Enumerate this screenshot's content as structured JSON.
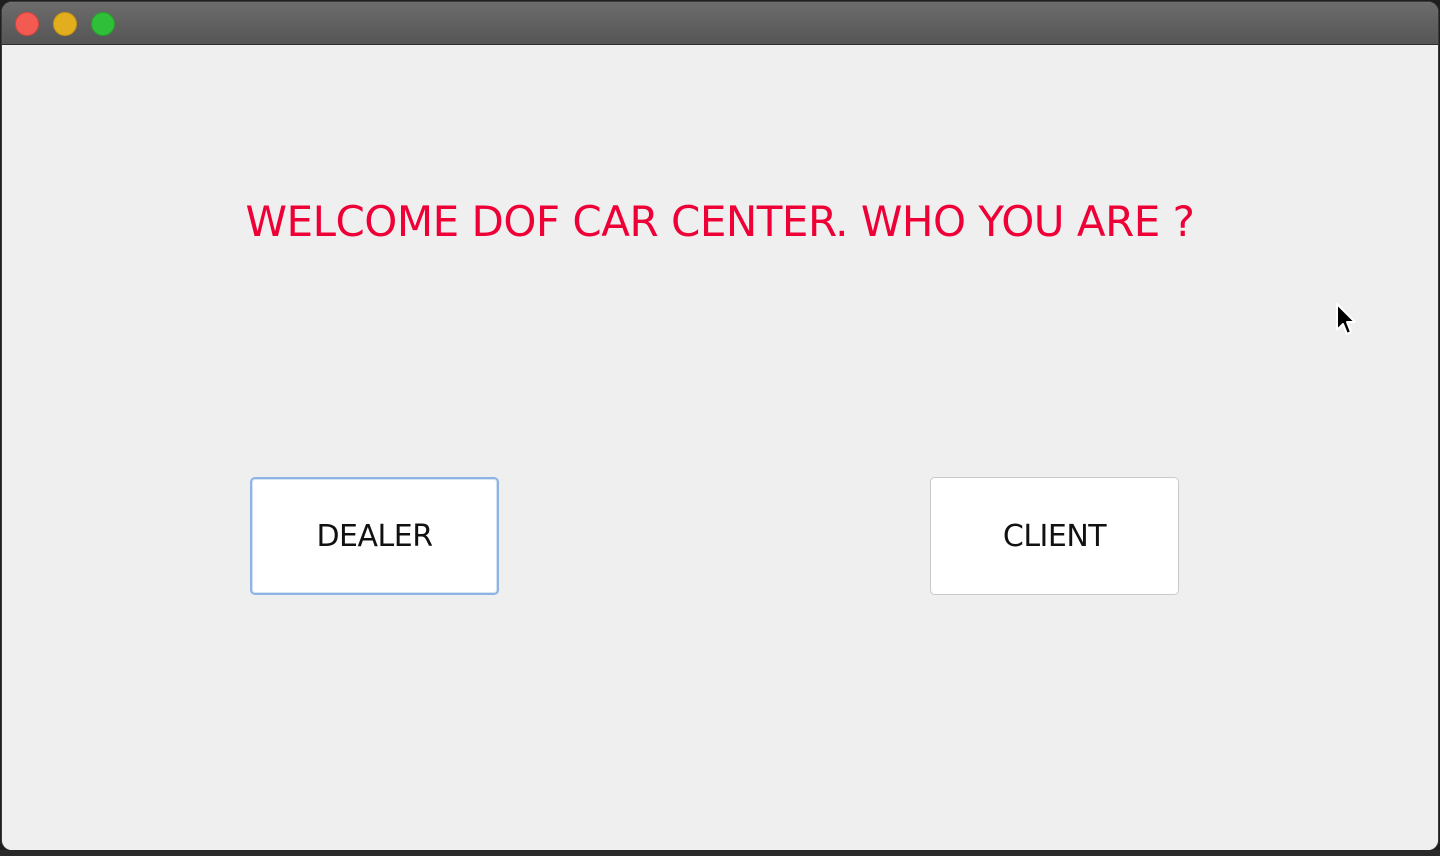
{
  "window": {
    "controls": {
      "close": "close-icon",
      "minimize": "minimize-icon",
      "zoom": "zoom-icon"
    }
  },
  "main": {
    "title": "WELCOME DOF CAR CENTER. WHO YOU ARE ?",
    "dealer_label": "DEALER",
    "client_label": "CLIENT"
  },
  "colors": {
    "title": "#ee0037",
    "background": "#efefef",
    "focus_ring": "#8fb3e3"
  }
}
